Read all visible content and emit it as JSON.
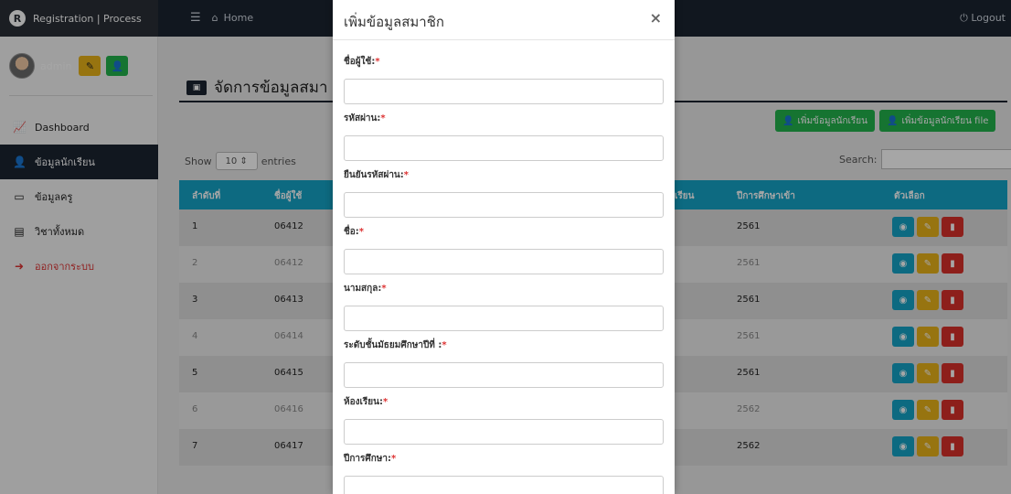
{
  "app": {
    "brand": "Registration | Process",
    "brand_logo": "R",
    "home": "Home",
    "logout": "Logout"
  },
  "sidebar": {
    "username": "admin",
    "items": [
      {
        "label": "Dashboard",
        "icon": "chart-icon"
      },
      {
        "label": "ข้อมูลนักเรียน",
        "icon": "user-tie-icon"
      },
      {
        "label": "ข้อมูลครู",
        "icon": "chalkboard-icon"
      },
      {
        "label": "วิชาทั้งหมด",
        "icon": "book-icon"
      },
      {
        "label": "ออกจากระบบ",
        "icon": "sign-out-icon"
      }
    ]
  },
  "main": {
    "title": "จัดการข้อมูลสมา",
    "add_student_label": "เพิ่มข้อมูลนักเรียน",
    "add_student_file_label": "เพิ่มข้อมูลนักเรียน file",
    "show": "Show",
    "entries_value": "10",
    "entries": "entries",
    "search_label": "Search:",
    "columns": [
      "ลำดับที่",
      "ชื่อผู้ใช้",
      "เรียน",
      "ปีการศึกษาเข้า",
      "ตัวเลือก"
    ],
    "rows": [
      {
        "no": "1",
        "user": "06412",
        "year": "2561"
      },
      {
        "no": "2",
        "user": "06412",
        "year": "2561"
      },
      {
        "no": "3",
        "user": "06413",
        "year": "2561"
      },
      {
        "no": "4",
        "user": "06414",
        "year": "2561"
      },
      {
        "no": "5",
        "user": "06415",
        "year": "2561"
      },
      {
        "no": "6",
        "user": "06416",
        "year": "2562"
      },
      {
        "no": "7",
        "user": "06417",
        "year": "2562"
      }
    ]
  },
  "modal": {
    "title": "เพิ่มข้อมูลสมาชิก",
    "close": "×",
    "fields": [
      {
        "label": "ชื่อผู้ใช้:"
      },
      {
        "label": "รหัสผ่าน:"
      },
      {
        "label": "ยืนยันรหัสผ่าน:"
      },
      {
        "label": "ชื่อ:"
      },
      {
        "label": "นามสกุล:"
      },
      {
        "label": "ระดับชั้นมัธยมศึกษาปีที่ :"
      },
      {
        "label": "ห้องเรียน:"
      },
      {
        "label": "ปีการศึกษา:"
      }
    ],
    "required_mark": "*"
  },
  "colors": {
    "navbar": "#1b2430",
    "table_header": "#14a3c7",
    "green": "#22b24c",
    "yellow": "#e8b21a",
    "red": "#d9302a"
  }
}
